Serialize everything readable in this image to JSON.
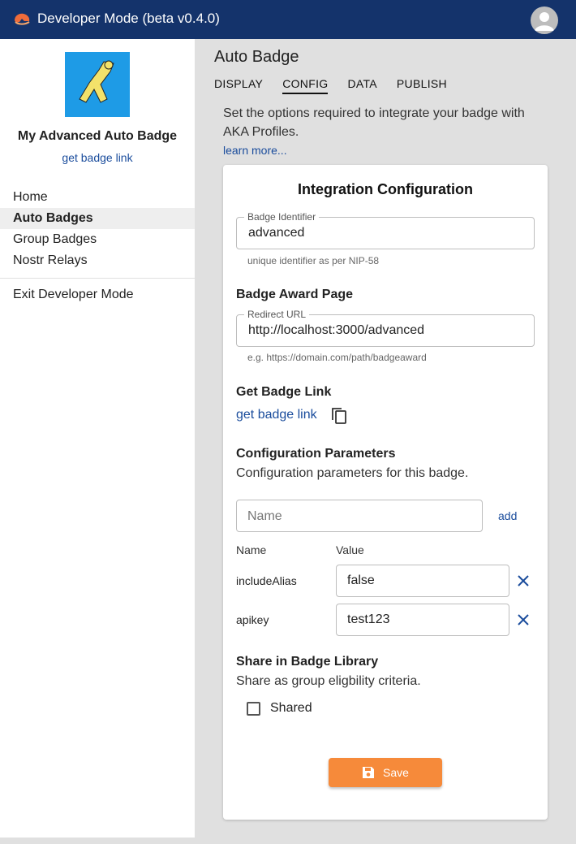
{
  "app": {
    "title": "Developer Mode (beta v0.4.0)"
  },
  "sidebar": {
    "badge_name": "My Advanced Auto Badge",
    "badge_link": "get badge link",
    "items": [
      {
        "label": "Home"
      },
      {
        "label": "Auto Badges"
      },
      {
        "label": "Group Badges"
      },
      {
        "label": "Nostr Relays"
      }
    ],
    "exit_label": "Exit Developer Mode"
  },
  "main": {
    "title": "Auto Badge",
    "tabs": [
      {
        "label": "DISPLAY"
      },
      {
        "label": "CONFIG"
      },
      {
        "label": "DATA"
      },
      {
        "label": "PUBLISH"
      }
    ],
    "intro": "Set the options required to integrate your badge with AKA Profiles.",
    "learn_more": "learn more..."
  },
  "card": {
    "title": "Integration Configuration",
    "badge_identifier": {
      "label": "Badge Identifier",
      "value": "advanced",
      "helper": "unique identifier as per NIP-58"
    },
    "award_page": {
      "heading": "Badge Award Page",
      "label": "Redirect URL",
      "value": "http://localhost:3000/advanced",
      "helper": "e.g. https://domain.com/path/badgeaward"
    },
    "get_link": {
      "heading": "Get Badge Link",
      "link": "get badge link"
    },
    "params": {
      "heading": "Configuration Parameters",
      "description": "Configuration parameters for this badge.",
      "name_placeholder": "Name",
      "add_label": "add",
      "col_name": "Name",
      "col_value": "Value",
      "rows": [
        {
          "name": "includeAlias",
          "value": "false"
        },
        {
          "name": "apikey",
          "value": "test123"
        }
      ]
    },
    "share": {
      "heading": "Share in Badge Library",
      "description": "Share as group eligbility criteria.",
      "checkbox_label": "Shared",
      "checked": false
    },
    "save_label": "Save"
  },
  "colors": {
    "topbar": "#14336b",
    "link": "#1a4c9c",
    "save": "#f68a3a",
    "badge_bg": "#1e9be6",
    "badge_fg": "#f3e26a"
  }
}
